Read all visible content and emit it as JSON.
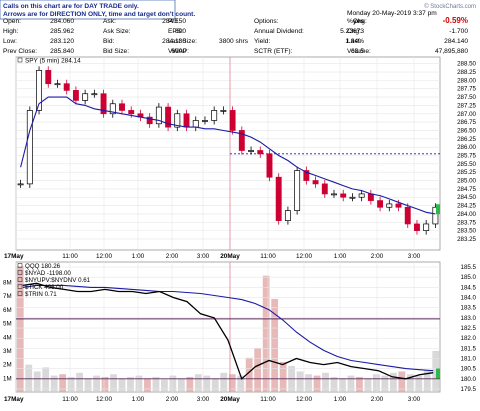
{
  "header": {
    "note_line1": "Calls on this chart are for DAY TRADE only.",
    "note_line2": "Arrows are for DIRECTION ONLY, time and target don't count.",
    "date": "Monday  20-May-2019  3:37 pm",
    "watermark": "© StockCharts.com",
    "stats": [
      {
        "label": "Open:",
        "value": "284.060"
      },
      {
        "label": "Ask:",
        "value": "284.150"
      },
      {
        "label": "P/E",
        "value": ""
      },
      {
        "label": "Options:",
        "value": "yes"
      },
      {
        "label": "%Chg:",
        "value": "-0.59%"
      },
      {
        "label": "High:",
        "value": "285.962"
      },
      {
        "label": "Ask Size:",
        "value": "800"
      },
      {
        "label": "EPS:",
        "value": ""
      },
      {
        "label": "Annual Dividend:",
        "value": "5.23673"
      },
      {
        "label": "Chg:",
        "value": "-1.700"
      },
      {
        "label": "Low:",
        "value": "283.120"
      },
      {
        "label": "Bid:",
        "value": "284.130"
      },
      {
        "label": "Last Size:",
        "value": "3800 shrs"
      },
      {
        "label": "Yield:",
        "value": "1.84%"
      },
      {
        "label": "Last:",
        "value": "284.140"
      },
      {
        "label": "Prev Close:",
        "value": "285.840"
      },
      {
        "label": "Bid Size:",
        "value": "6000"
      },
      {
        "label": "VWAP:",
        "value": ""
      },
      {
        "label": "SCTR (ETF):",
        "value": "63.5"
      },
      {
        "label": "Volume:",
        "value": "47,895,880"
      }
    ]
  },
  "colors": {
    "up": "#000000",
    "down": "#cc0033",
    "ma": "#1a1aa6",
    "ref_line": "#1a1aa6",
    "ref_line_volume": "#5a2a5a",
    "grid": "#e6e6e6",
    "pct_chg": "#cc0000",
    "last_marker": "#2db84a",
    "volume_bar": "#e2a8a8",
    "volume_bar_gray": "#cfcfcf"
  },
  "chart_data": [
    {
      "type": "candlestick",
      "legend": "SPY (5 min) 284.14",
      "ylim": [
        282.92,
        288.7
      ],
      "y_ticks": [
        283.25,
        283.5,
        283.75,
        284.0,
        284.25,
        284.5,
        284.75,
        285.0,
        285.25,
        285.5,
        285.75,
        286.0,
        286.25,
        286.5,
        286.75,
        287.0,
        287.25,
        287.5,
        287.75,
        288.0,
        288.25,
        288.5
      ],
      "x_ticks": [
        "17May",
        "11:00",
        "12:00",
        "1:00",
        "2:00",
        "3:00",
        "20May",
        "11:00",
        "12:00",
        "1:00",
        "2:00",
        "3:00"
      ],
      "reference_line": 285.8,
      "last": 284.14,
      "grid": true,
      "ma_series": [
        285.4,
        286.5,
        287.3,
        287.5,
        287.5,
        287.5,
        287.3,
        287.25,
        287.15,
        287.1,
        287.05,
        287.0,
        286.95,
        286.9,
        286.85,
        286.8,
        286.7,
        286.65,
        286.6,
        286.6,
        286.55,
        286.55,
        286.5,
        286.45,
        286.4,
        286.3,
        286.15,
        285.95,
        285.75,
        285.6,
        285.4,
        285.25,
        285.15,
        285.05,
        284.95,
        284.85,
        284.75,
        284.7,
        284.6,
        284.55,
        284.45,
        284.35,
        284.25,
        284.15,
        284.05,
        284.0
      ],
      "close_series": [
        284.9,
        287.1,
        288.3,
        287.9,
        287.9,
        287.7,
        287.4,
        287.6,
        287.6,
        287.0,
        287.3,
        287.1,
        287.0,
        286.9,
        286.7,
        287.2,
        286.6,
        287.0,
        286.6,
        286.8,
        286.8,
        287.1,
        287.1,
        286.5,
        285.9,
        285.9,
        285.8,
        285.1,
        283.8,
        284.1,
        285.3,
        285.0,
        284.9,
        284.6,
        284.6,
        284.5,
        284.5,
        284.6,
        284.4,
        284.2,
        284.3,
        284.2,
        283.7,
        283.5,
        283.7,
        284.2
      ]
    },
    {
      "type": "line",
      "series": [
        {
          "name": "QQQ",
          "value": "180.26"
        },
        {
          "name": "$NYAD",
          "value": "-1198.00"
        },
        {
          "name": "$NYUPV:$NYDNV",
          "value": "0.61"
        },
        {
          "name": "$TICK",
          "value": "496.00"
        },
        {
          "name": "$TRIN",
          "value": "0.71"
        }
      ],
      "legend": [
        "QQQ 180.26",
        "$NYAD -1198.00",
        "$NYUPV:$NYDNV 0.61",
        "$TICK 496.00",
        "$TRIN 0.71"
      ],
      "ylim": [
        179.35,
        185.75
      ],
      "y_ticks": [
        179.5,
        180.0,
        180.5,
        181.0,
        181.5,
        182.0,
        182.5,
        183.0,
        183.5,
        184.0,
        184.5,
        185.0,
        185.5
      ],
      "volume_ticks": [
        "1M",
        "2M",
        "3M",
        "4M",
        "5M",
        "6M",
        "7M",
        "8M"
      ],
      "x_ticks": [
        "17May",
        "11:00",
        "12:00",
        "1:00",
        "2:00",
        "3:00",
        "20May",
        "11:00",
        "12:00",
        "1:00",
        "2:00",
        "3:00"
      ],
      "reference_line": 182.95,
      "reference_line_low": 180.0,
      "last": 180.26,
      "ma_series": [
        184.5,
        184.6,
        184.6,
        184.6,
        184.55,
        184.5,
        184.5,
        184.45,
        184.4,
        184.35,
        184.3,
        184.3,
        184.25,
        184.2,
        184.1,
        184.0,
        183.9,
        183.7,
        183.4,
        182.9,
        182.3,
        181.8,
        181.4,
        181.1,
        180.9,
        180.8,
        180.7,
        180.6,
        180.5,
        180.45,
        180.4
      ],
      "close_series": [
        184.6,
        184.7,
        184.5,
        184.4,
        184.3,
        184.3,
        184.4,
        184.3,
        184.3,
        184.2,
        184.3,
        184.0,
        183.8,
        183.2,
        183.0,
        181.9,
        180.0,
        180.6,
        180.9,
        180.7,
        181.0,
        180.8,
        180.7,
        180.8,
        180.6,
        180.5,
        180.4,
        180.1,
        180.0,
        180.2,
        180.3
      ],
      "volume": [
        9.2,
        2.0,
        1.5,
        1.8,
        1.2,
        1.3,
        1.1,
        1.4,
        1.0,
        1.2,
        1.1,
        1.3,
        1.0,
        1.1,
        1.2,
        1.0,
        1.1,
        0.9,
        1.2,
        1.0,
        1.1,
        1.3,
        1.2,
        1.0,
        1.4,
        1.3,
        1.2,
        2.5,
        3.2,
        8.5,
        6.8,
        2.2,
        1.9,
        1.5,
        1.3,
        1.2,
        1.4,
        1.1,
        1.0,
        1.2,
        1.1,
        1.0,
        1.3,
        1.2,
        1.4,
        1.5,
        1.3,
        1.2,
        1.6,
        3.0
      ],
      "volume_ylim": [
        0,
        9.5
      ]
    }
  ]
}
